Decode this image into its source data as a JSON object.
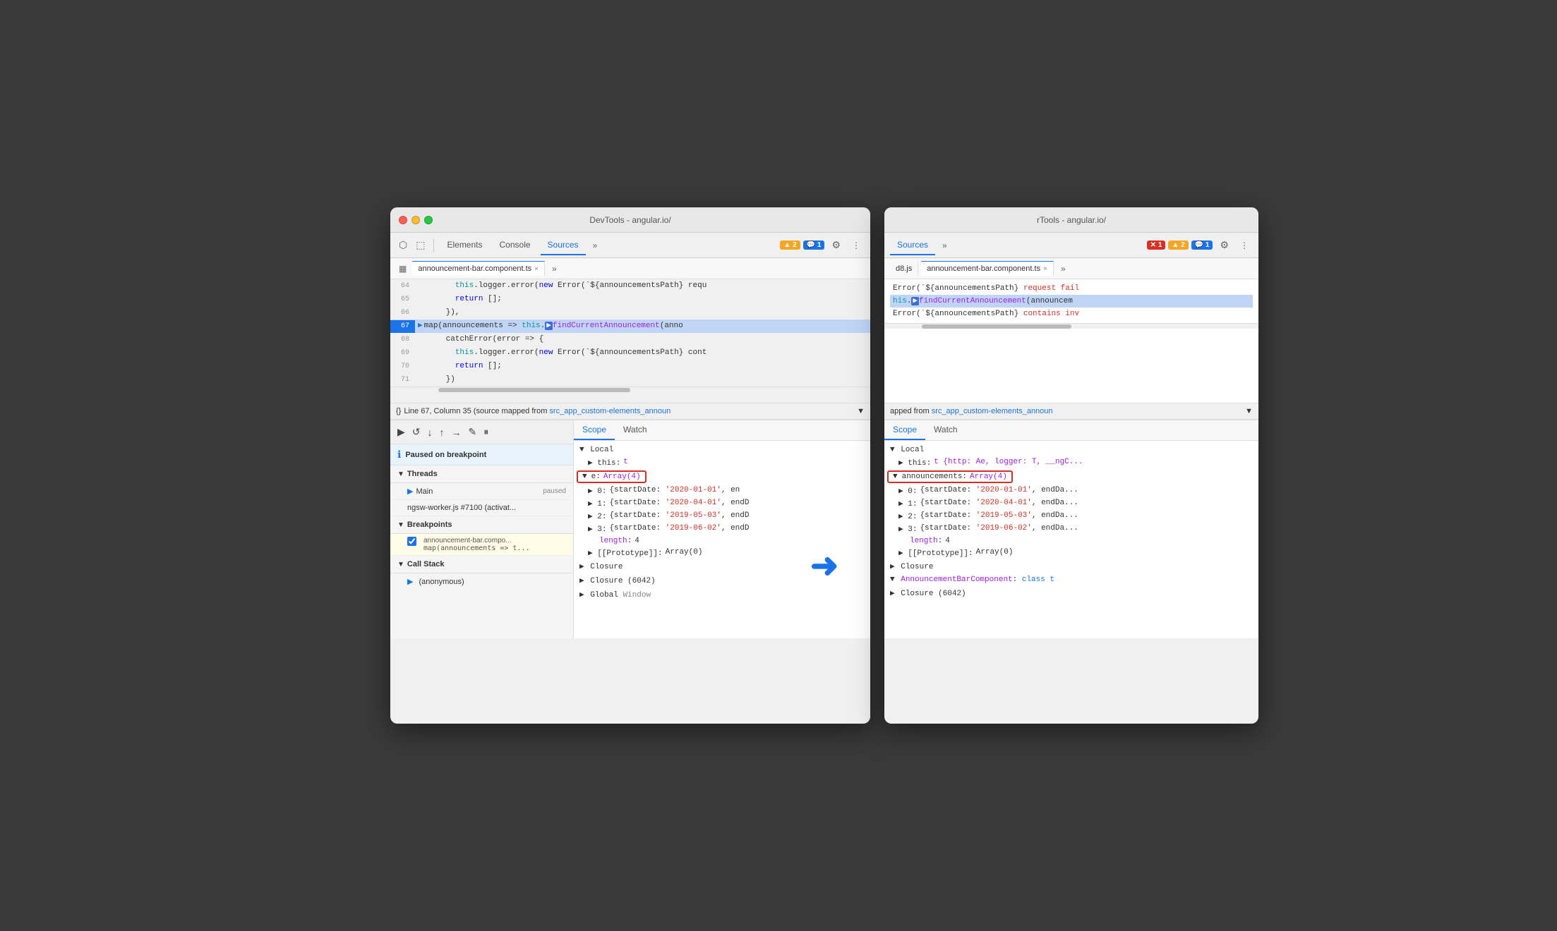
{
  "left_window": {
    "title": "DevTools - angular.io/",
    "tabs": [
      "Elements",
      "Console",
      "Sources",
      ">>"
    ],
    "active_tab": "Sources",
    "badges": {
      "warning": "▲ 2",
      "chat": "💬 1"
    },
    "file_tab": "announcement-bar.component.ts",
    "code_lines": [
      {
        "num": "64",
        "content": "        this.logger.error(new Error(`${announcementsPath} requ",
        "highlight": false
      },
      {
        "num": "65",
        "content": "        return [];",
        "highlight": false
      },
      {
        "num": "66",
        "content": "      }),",
        "highlight": false
      },
      {
        "num": "67",
        "content": "      map(announcements => this.findCurrentAnnouncement(anno",
        "highlight": true,
        "breakpoint": true
      },
      {
        "num": "68",
        "content": "      catchError(error => {",
        "highlight": false
      },
      {
        "num": "69",
        "content": "        this.logger.error(new Error(`${announcementsPath} cont",
        "highlight": false
      },
      {
        "num": "70",
        "content": "        return [];",
        "highlight": false
      },
      {
        "num": "71",
        "content": "      })",
        "highlight": false
      }
    ],
    "status_bar": {
      "format": "{}",
      "text": "Line 67, Column 35 (source mapped from",
      "link": "src_app_custom-elements_announ"
    },
    "debug_controls": [
      "▶",
      "↺",
      "↓",
      "↑",
      "→",
      "✎",
      "⏸"
    ],
    "paused_banner": "Paused on breakpoint",
    "threads": {
      "label": "Threads",
      "items": [
        {
          "name": "Main",
          "status": "paused",
          "active": true
        },
        {
          "name": "ngsw-worker.js #7100 (activat...",
          "status": "",
          "active": false
        }
      ]
    },
    "breakpoints": {
      "label": "Breakpoints",
      "items": [
        {
          "file": "announcement-bar.compo...",
          "code": "map(announcements => t..."
        }
      ]
    },
    "call_stack": {
      "label": "Call Stack",
      "items": [
        "(anonymous)"
      ]
    },
    "scope": {
      "tabs": [
        "Scope",
        "Watch"
      ],
      "active_tab": "Scope",
      "sections": {
        "local": {
          "label": "Local",
          "items": [
            {
              "key": "▶ this:",
              "val": "t"
            },
            {
              "key": "▼ e:",
              "val": "Array(4)",
              "highlighted": true
            },
            {
              "key": "  ▶ 0:",
              "val": "{startDate: '2020-01-01', en..."
            },
            {
              "key": "  ▶ 1:",
              "val": "{startDate: '2020-04-01', endD..."
            },
            {
              "key": "  ▶ 2:",
              "val": "{startDate: '2019-05-03', endD..."
            },
            {
              "key": "  ▶ 3:",
              "val": "{startDate: '2019-06-02', endD..."
            },
            {
              "key": "    length:",
              "val": "4"
            },
            {
              "key": "  ▶ [[Prototype]]:",
              "val": "Array(0)"
            }
          ]
        },
        "closure": {
          "label": "Closure"
        },
        "closure2": {
          "label": "Closure (6042)"
        },
        "global": {
          "label": "Global",
          "val": "Window"
        }
      }
    }
  },
  "right_window": {
    "title": "rTools - angular.io/",
    "tabs": [
      "Sources",
      ">>"
    ],
    "active_tab": "Sources",
    "badges": {
      "error": "✕ 1",
      "warning": "▲ 2",
      "chat": "💬 1"
    },
    "file_tabs": [
      "d8.js",
      "announcement-bar.component.ts"
    ],
    "code_lines": [
      {
        "num": "",
        "content": "Error(`${announcementsPath} request fail",
        "highlight": false
      },
      {
        "num": "",
        "content": "his.findCurrentAnnouncement(announcem",
        "highlight": true
      },
      {
        "num": "",
        "content": "Error(`${announcementsPath} contains inv",
        "highlight": false
      }
    ],
    "status_bar": {
      "text": "apped from",
      "link": "src_app_custom-elements_announ"
    },
    "scope": {
      "tabs": [
        "Scope",
        "Watch"
      ],
      "active_tab": "Scope",
      "sections": {
        "local": {
          "label": "Local",
          "items": [
            {
              "key": "▶ this:",
              "val": "t {http: Ae, logger: T, __ngC..."
            },
            {
              "key": "▼ announcements:",
              "val": "Array(4)",
              "highlighted": true
            },
            {
              "key": "  ▶ 0:",
              "val": "{startDate: '2020-01-01', endDa..."
            },
            {
              "key": "  ▶ 1:",
              "val": "{startDate: '2020-04-01', endDa..."
            },
            {
              "key": "  ▶ 2:",
              "val": "{startDate: '2019-05-03', endDa..."
            },
            {
              "key": "  ▶ 3:",
              "val": "{startDate: '2019-06-02', endDa..."
            },
            {
              "key": "    length:",
              "val": "4"
            },
            {
              "key": "  ▶ [[Prototype]]:",
              "val": "Array(0)"
            }
          ]
        },
        "closure": {
          "label": "Closure"
        },
        "closure2": {
          "label": "AnnouncementBarComponent:",
          "val": "class t"
        },
        "closure3": {
          "label": "Closure (6042)"
        }
      }
    }
  },
  "blue_arrow": "→"
}
